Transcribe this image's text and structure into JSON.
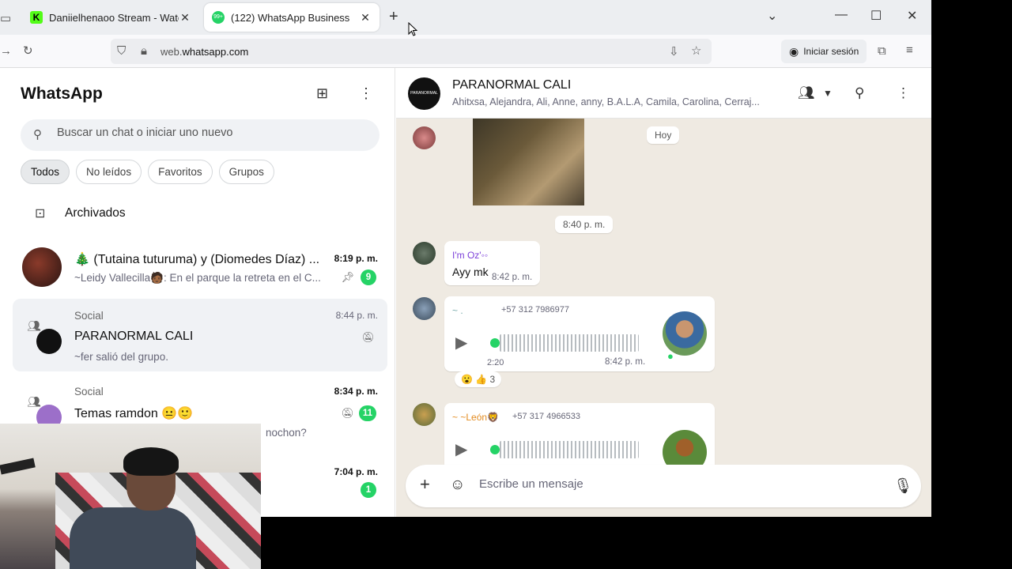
{
  "browser": {
    "tabs": [
      {
        "title": "Daniielhenaoo Stream - Watch",
        "favicon": "kick-favicon"
      },
      {
        "title": "(122) WhatsApp Business",
        "favicon": "whatsapp-favicon"
      }
    ],
    "url_host": "web.",
    "url_domain": "whatsapp.com",
    "signin_label": "Iniciar sesión"
  },
  "sidebar": {
    "title": "WhatsApp",
    "search_placeholder": "Buscar un chat o iniciar uno nuevo",
    "filters": [
      "Todos",
      "No leídos",
      "Favoritos",
      "Grupos"
    ],
    "archived_label": "Archivados",
    "chats": [
      {
        "category": "",
        "name": "🎄 (Tutaina tuturuma)  y (Diomedes Díaz) ...",
        "preview": "~Leidy Vallecilla🧑🏾: En el parque la retreta en el C...",
        "time": "8:19 p. m.",
        "unread": "9"
      },
      {
        "category": "Social",
        "name": "PARANORMAL CALI",
        "preview": "~fer salió del grupo.",
        "time": "8:44 p. m.",
        "unread": ""
      },
      {
        "category": "Social",
        "name": "Temas ramdon 😐🙂",
        "preview": "nochon?",
        "time": "8:34 p. m.",
        "unread": "11"
      },
      {
        "category": "",
        "name": "",
        "preview": "",
        "time": "7:04 p. m.",
        "unread": "1"
      }
    ]
  },
  "conversation": {
    "group_name": "PARANORMAL CALI",
    "members": "Ahitxsa, Alejandra, Ali, Anne, anny, B.A.L.A, Camila, Carolina, Cerraj...",
    "date_pill": "Hoy",
    "time_pill": "8:40 p. m.",
    "messages": [
      {
        "sender": "I'm Oz'◦◦",
        "text": "Ayy mk",
        "time": "8:42 p. m."
      },
      {
        "sender": "~ .",
        "phone": "+57 312 7986977",
        "duration": "2:20",
        "time": "8:42 p. m.",
        "reactions": "😮 👍 3"
      },
      {
        "sender": "~ ~León🦁",
        "phone": "+57 317 4966533"
      }
    ],
    "composer_placeholder": "Escribe un mensaje"
  },
  "colors": {
    "accent": "#25d366",
    "chat_bg": "#efeae2",
    "sender1": "#7b3fd9",
    "sender2": "#e38b1f"
  }
}
